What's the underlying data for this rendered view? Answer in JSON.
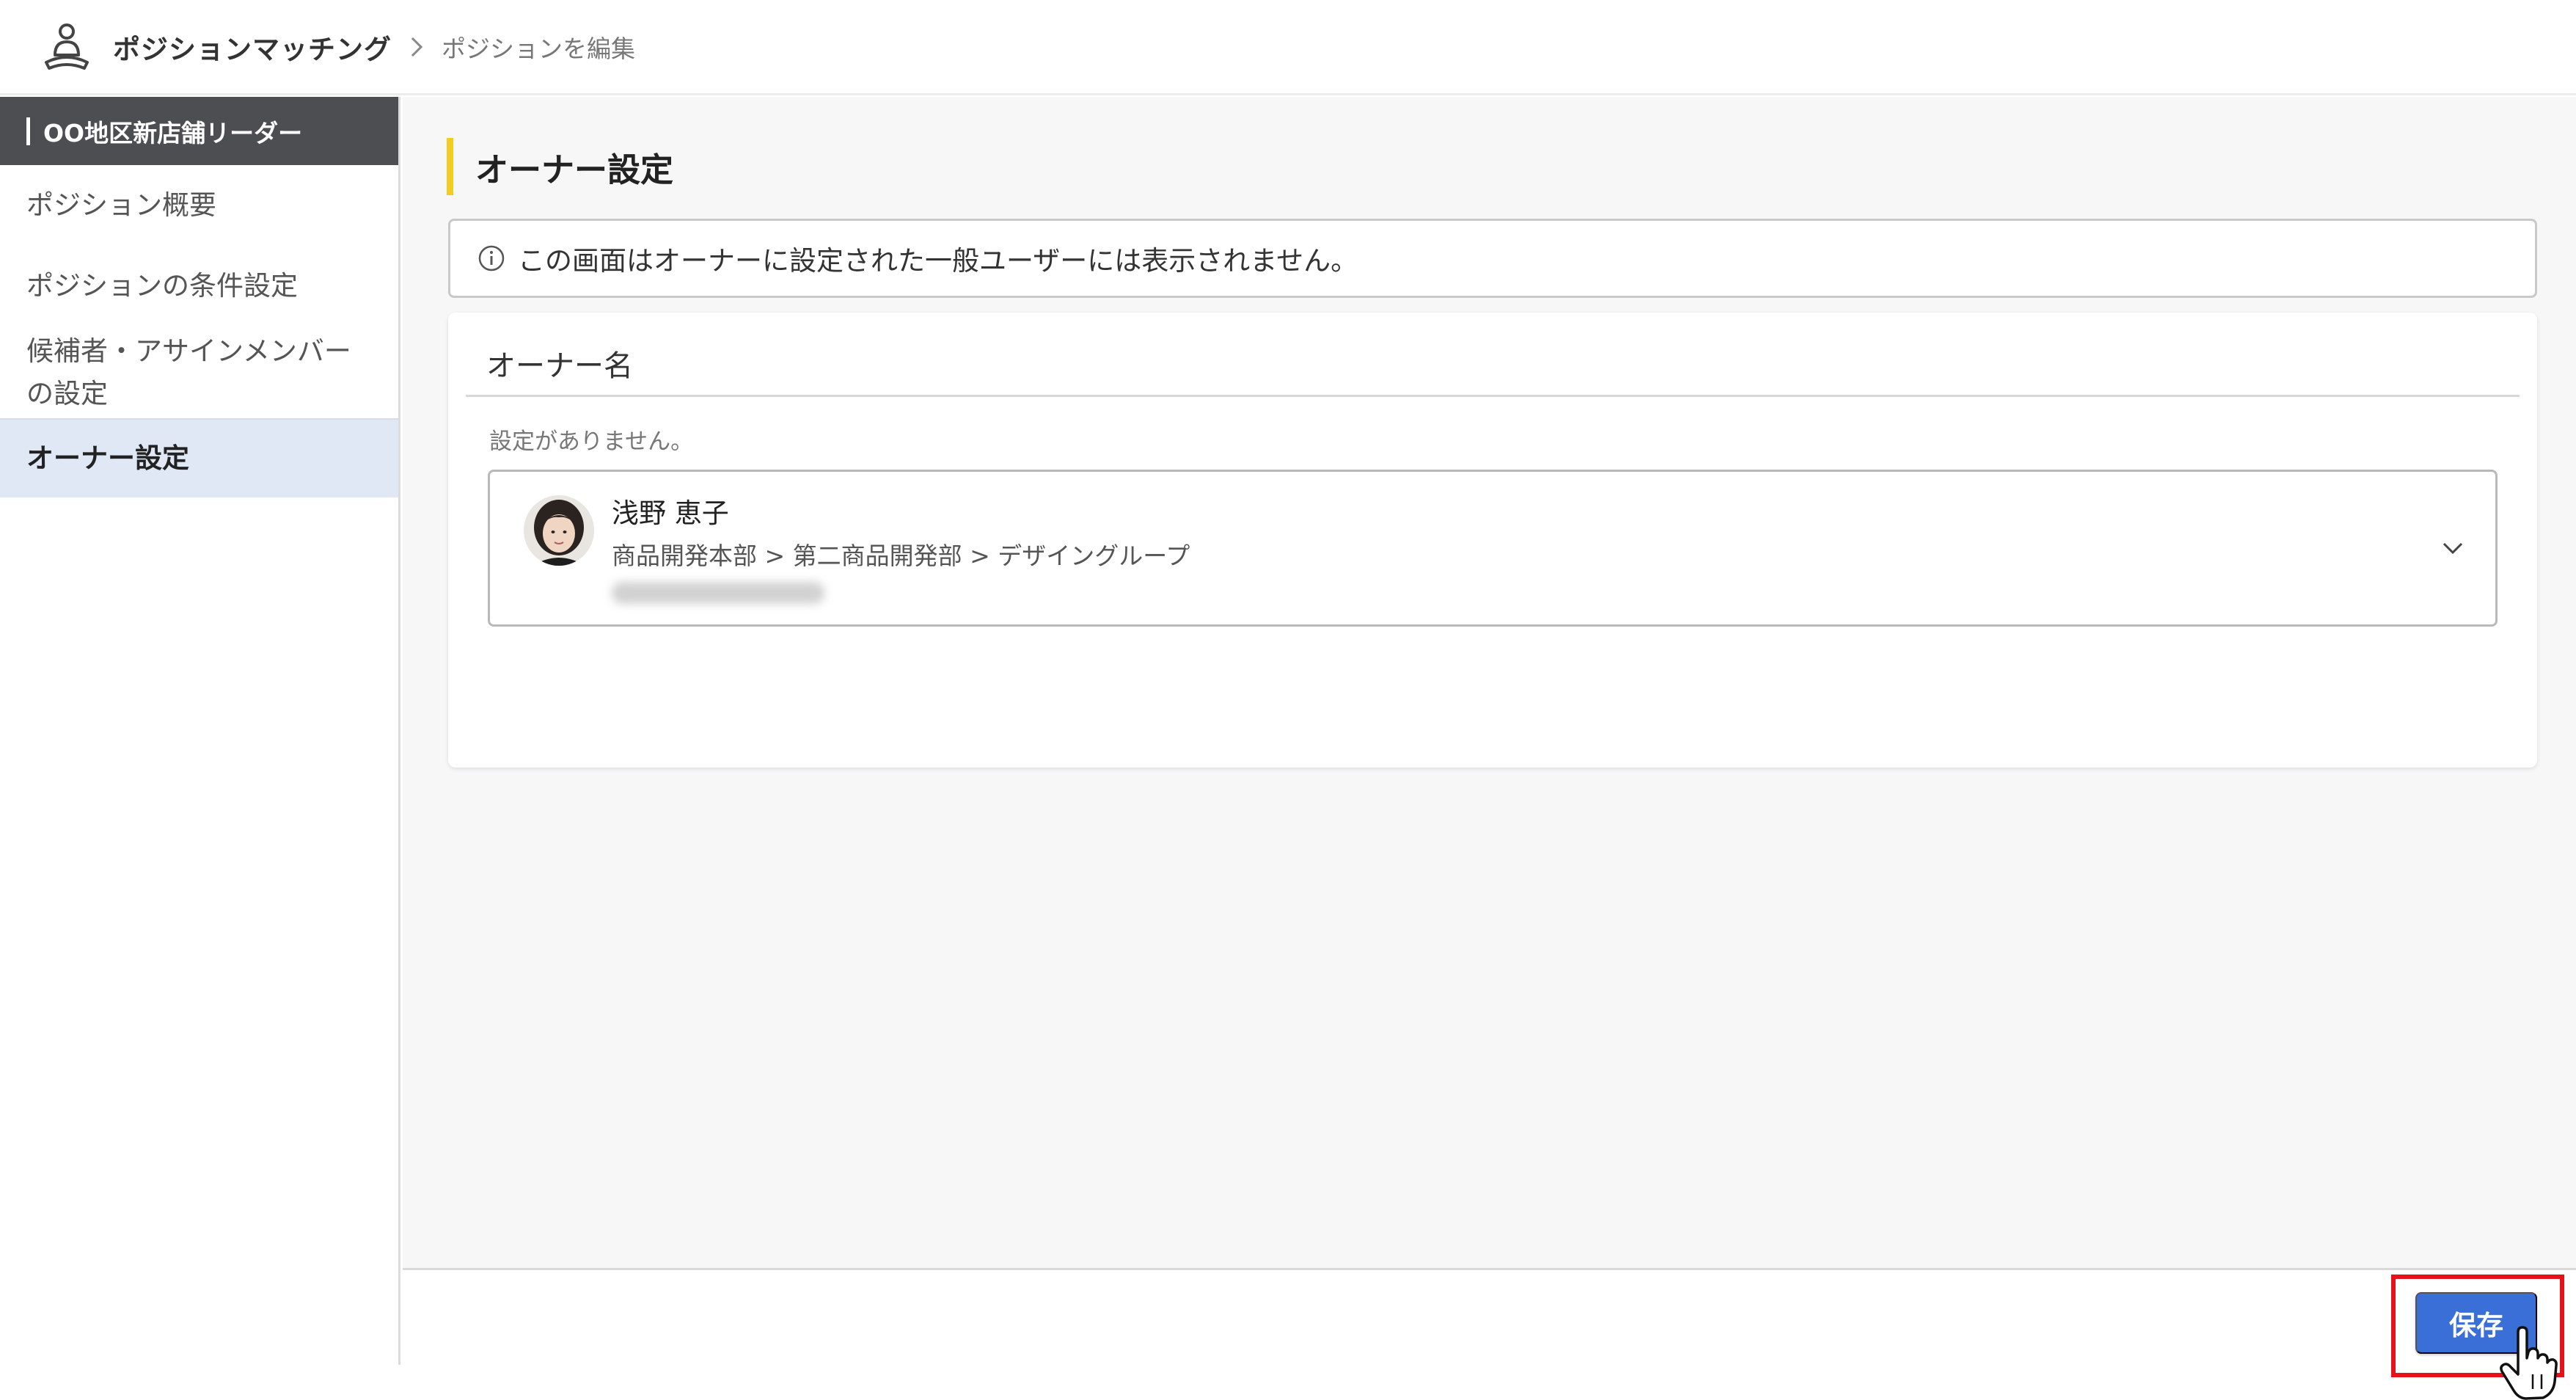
{
  "header": {
    "app_icon": "position-matching-person-icon",
    "app_title": "ポジションマッチング",
    "breadcrumb_separator_icon": "chevron-right-icon",
    "breadcrumb_current": "ポジションを編集"
  },
  "sidebar": {
    "position_name": "OO地区新店舗リーダー",
    "items": [
      {
        "label": "ポジション概要",
        "active": false
      },
      {
        "label": "ポジションの条件設定",
        "active": false
      },
      {
        "label_line1": "候補者・アサインメンバー",
        "label_line2": "の設定",
        "active": false
      },
      {
        "label": "オーナー設定",
        "active": true
      }
    ]
  },
  "main": {
    "page_title": "オーナー設定",
    "notice": {
      "icon": "info-icon",
      "text": "この画面はオーナーに設定された一般ユーザーには表示されません。"
    },
    "owner_card": {
      "title": "オーナー名",
      "empty_text": "設定がありません。",
      "selected_owner": {
        "name": "浅野 恵子",
        "department": "商品開発本部 > 第二商品開発部 > デザイングループ",
        "avatar_icon": "user-avatar"
      },
      "dropdown_icon": "chevron-down-icon"
    }
  },
  "footer": {
    "save_label": "保存",
    "highlight_color": "#e6121a",
    "cursor_icon": "hand-pointer-icon"
  },
  "colors": {
    "accent_yellow": "#f4cc1f",
    "primary_button": "#3a6fd8",
    "sidebar_header": "#4d4e52",
    "sidebar_active": "#e1e8f5"
  }
}
